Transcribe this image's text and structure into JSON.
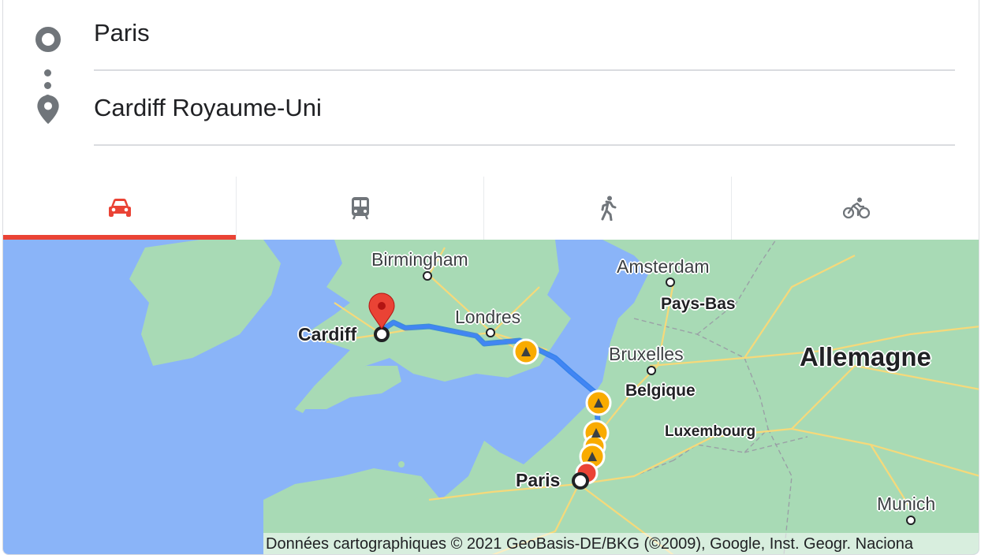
{
  "route": {
    "origin": "Paris",
    "destination": "Cardiff Royaume-Uni"
  },
  "travel_modes": [
    {
      "mode": "driving",
      "icon": "car-icon",
      "selected": true
    },
    {
      "mode": "transit",
      "icon": "train-icon",
      "selected": false
    },
    {
      "mode": "walking",
      "icon": "walking-icon",
      "selected": false
    },
    {
      "mode": "cycling",
      "icon": "bicycle-icon",
      "selected": false
    }
  ],
  "map": {
    "labels": {
      "birmingham": "Birmingham",
      "londres": "Londres",
      "cardiff": "Cardiff",
      "amsterdam": "Amsterdam",
      "pays_bas": "Pays-Bas",
      "bruxelles": "Bruxelles",
      "belgique": "Belgique",
      "luxembourg": "Luxembourg",
      "allemagne": "Allemagne",
      "paris": "Paris",
      "munich": "Munich"
    },
    "attribution": "Données cartographiques © 2021 GeoBasis-DE/BKG (©2009), Google, Inst. Geogr. Naciona",
    "colors": {
      "water": "#8ab4f8",
      "land": "#a8dab5",
      "route": "#4285f4",
      "marker": "#ea4335",
      "roadwork": "#f9ab00",
      "accent": "#ea4335"
    }
  }
}
